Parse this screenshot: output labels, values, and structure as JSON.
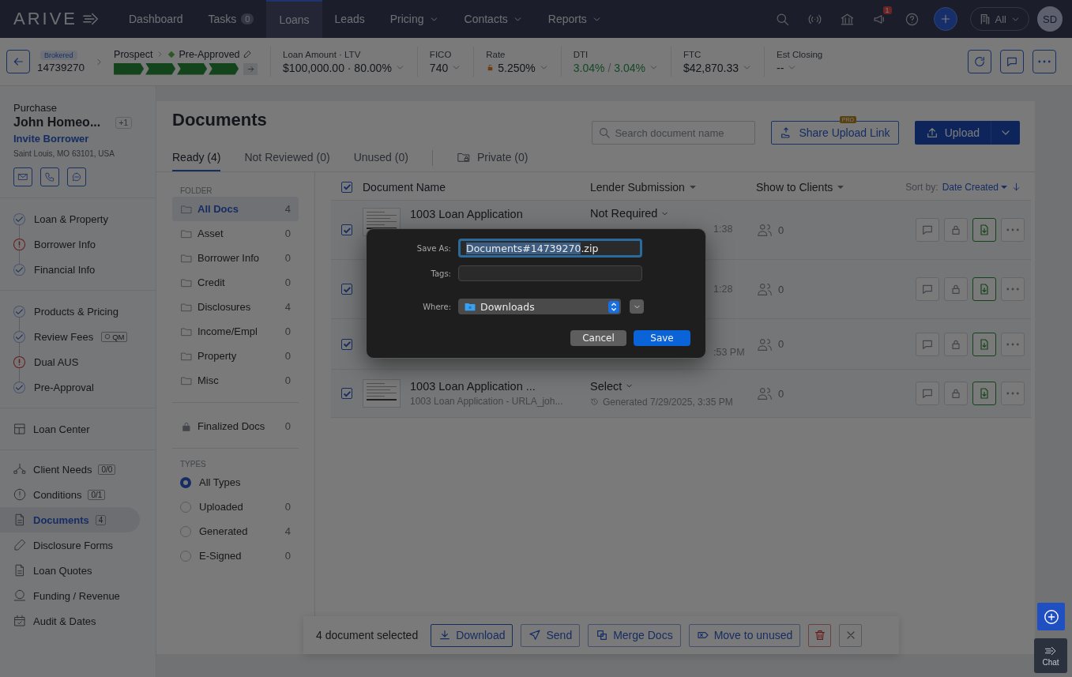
{
  "topbar": {
    "logo": "ARIVE",
    "nav": [
      {
        "label": "Dashboard",
        "selected": false,
        "dropdown": false
      },
      {
        "label": "Tasks",
        "badge": "0",
        "selected": false,
        "dropdown": false
      },
      {
        "label": "Loans",
        "selected": true,
        "dropdown": false
      },
      {
        "label": "Leads",
        "selected": false,
        "dropdown": false
      },
      {
        "label": "Pricing",
        "selected": false,
        "dropdown": true
      },
      {
        "label": "Contacts",
        "selected": false,
        "dropdown": true
      },
      {
        "label": "Reports",
        "selected": false,
        "dropdown": true
      }
    ],
    "notification_count": "1",
    "scope": "All",
    "avatar": "SD"
  },
  "loan_bar": {
    "channel": "Brokered",
    "loan_number": "14739270",
    "stage": "Prospect",
    "next_stage": "Pre-Approved",
    "progress": [
      {
        "done": true
      },
      {
        "done": true
      },
      {
        "done": true
      },
      {
        "done": true
      }
    ],
    "metrics": [
      {
        "kind": "plain",
        "label": "Loan Amount · LTV",
        "value": "$100,000.00 · 80.00%"
      },
      {
        "kind": "plain",
        "label": "FICO",
        "value": "740"
      },
      {
        "kind": "locked",
        "label": "Rate",
        "value": "5.250%"
      },
      {
        "kind": "split",
        "label": "DTI",
        "front": "3.04%",
        "separator": "/",
        "back": "3.04%"
      },
      {
        "kind": "plain",
        "label": "FTC",
        "value": "$42,870.33"
      },
      {
        "kind": "plain",
        "label": "Est Closing",
        "value": "--"
      }
    ]
  },
  "sidebar": {
    "loan_type": "Purchase",
    "borrower": "John Homeo...",
    "extra_borrowers": "+1",
    "invite": "Invite Borrower",
    "address": "Saint Louis, MO 63101, USA",
    "step_groups": [
      [
        {
          "label": "Loan & Property",
          "complete": true
        },
        {
          "label": "Borrower Info",
          "complete": false
        },
        {
          "label": "Financial Info",
          "complete": true
        }
      ],
      [
        {
          "label": "Products & Pricing",
          "complete": true
        },
        {
          "label": "Review Fees",
          "complete": true,
          "tag": "QM"
        },
        {
          "label": "Dual AUS",
          "complete": false
        },
        {
          "label": "Pre-Approval",
          "complete": true
        }
      ]
    ],
    "home": "Loan Center",
    "nav": [
      {
        "label": "Client Needs",
        "badge": "0/0",
        "selected": false
      },
      {
        "label": "Conditions",
        "badge": "0/1",
        "selected": false
      },
      {
        "label": "Documents",
        "badge": "4",
        "selected": true
      },
      {
        "label": "Disclosure Forms",
        "selected": false
      },
      {
        "label": "Loan Quotes",
        "selected": false
      },
      {
        "label": "Funding / Revenue",
        "selected": false
      },
      {
        "label": "Audit & Dates",
        "selected": false
      }
    ]
  },
  "documents": {
    "title": "Documents",
    "tabs": [
      {
        "label": "Ready (4)",
        "selected": true,
        "kind": "plain"
      },
      {
        "label": "Not Reviewed (0)",
        "selected": false,
        "kind": "plain"
      },
      {
        "label": "Unused (0)",
        "selected": false,
        "kind": "plain"
      },
      {
        "label": "Private (0)",
        "selected": false,
        "kind": "private"
      }
    ],
    "search_placeholder": "Search document name",
    "share_button": "Share Upload Link",
    "pro_badge": "PRO",
    "upload_button": "Upload",
    "folder_heading": "FOLDER",
    "folders": [
      {
        "label": "All Docs",
        "count": "4",
        "selected": true
      },
      {
        "label": "Asset",
        "count": "0",
        "selected": false
      },
      {
        "label": "Borrower Info",
        "count": "0",
        "selected": false
      },
      {
        "label": "Credit",
        "count": "0",
        "selected": false
      },
      {
        "label": "Disclosures",
        "count": "4",
        "selected": false
      },
      {
        "label": "Income/Empl",
        "count": "0",
        "selected": false
      },
      {
        "label": "Property",
        "count": "0",
        "selected": false
      },
      {
        "label": "Misc",
        "count": "0",
        "selected": false
      }
    ],
    "finalized": {
      "label": "Finalized Docs",
      "count": "0"
    },
    "types_heading": "TYPES",
    "types": [
      {
        "label": "All Types",
        "selected": true
      },
      {
        "label": "Uploaded",
        "count": "0",
        "selected": false
      },
      {
        "label": "Generated",
        "count": "4",
        "selected": false
      },
      {
        "label": "E-Signed",
        "count": "0",
        "selected": false
      }
    ],
    "table": {
      "all_checked": true,
      "columns": [
        "Document Name",
        "Lender Submission",
        "Show to Clients"
      ],
      "sort_label": "Sort by:",
      "sort_value": "Date Created",
      "rows": [
        {
          "kind": "covered",
          "checked": true,
          "thumbnail": true,
          "title": "1003 Loan Application",
          "lender": "Not Required",
          "time": "1:38",
          "clients": "0"
        },
        {
          "kind": "covered",
          "checked": true,
          "thumbnail": false,
          "time": "1:28",
          "clients": "0"
        },
        {
          "kind": "covered",
          "checked": true,
          "thumbnail": false,
          "time": ":53 PM",
          "clients": "0"
        },
        {
          "kind": "full",
          "checked": true,
          "thumbnail": true,
          "title": "1003 Loan Application ...",
          "subtitle": "1003 Loan Application - URLA_joh...",
          "lender": "Select",
          "time": "Generated 7/29/2025, 3:35 PM",
          "clients": "0"
        }
      ]
    }
  },
  "selection_bar": {
    "summary": "4 document selected",
    "actions": [
      {
        "label": "Download",
        "selected": true
      },
      {
        "label": "Send",
        "selected": false
      },
      {
        "label": "Merge Docs",
        "selected": false
      },
      {
        "label": "Move to unused",
        "selected": false
      }
    ]
  },
  "chat_button": "Chat",
  "save_dialog": {
    "save_as_label": "Save As:",
    "selected_part": "Documents#14739270",
    "rest": ".zip",
    "tags_label": "Tags:",
    "where_label": "Where:",
    "where_value": "Downloads",
    "cancel": "Cancel",
    "save": "Save"
  }
}
